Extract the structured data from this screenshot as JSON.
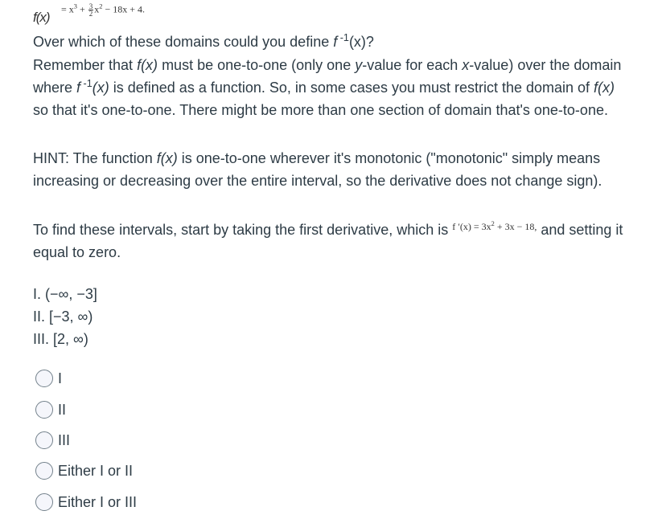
{
  "header": {
    "fx_label": "f(x)",
    "rhs_a": "= x",
    "rhs_a_exp": "3",
    "rhs_plus1": " + ",
    "frac_num": "3",
    "frac_den": "2",
    "rhs_x2": "x",
    "rhs_x2_exp": "2",
    "rhs_rest": " − 18x + 4."
  },
  "question": {
    "line1_prefix": "Over which of these domains could you define ",
    "line1_f": "f",
    "line1_exp": " -1",
    "line1_suffix": "(x)?",
    "para1_a": "Remember that ",
    "para1_fx": "f(x)",
    "para1_b": " must be one-to-one (only one ",
    "para1_y": "y",
    "para1_c": "-value for each ",
    "para1_x": "x",
    "para1_d": "-value) over the domain where ",
    "para1_f": "f",
    "para1_exp": " -1",
    "para1_x2": "(x)",
    "para1_e": " is defined as a function. So, in some cases you must restrict the domain of ",
    "para1_fx2": "f(x)",
    "para1_f_end": " so that it's one-to-one. There might be more than one section of domain that's one-to-one.",
    "hint_a": "HINT: The function ",
    "hint_fx": "f(x)",
    "hint_b": " is one-to-one wherever it's monotonic (\"monotonic\" simply means increasing or decreasing over the entire interval, so the derivative does not change sign).",
    "find_a": "To find these intervals, start by taking the first derivative, which is ",
    "deriv_lhs": "f ′(x) = 3x",
    "deriv_exp": "2",
    "deriv_rest": " + 3x − 18,",
    "find_b": " and setting it equal to zero."
  },
  "intervals": [
    "I. (−∞, −3]",
    "II. [−3, ∞)",
    "III. [2, ∞)"
  ],
  "options": [
    {
      "label": "I",
      "selected": false
    },
    {
      "label": "II",
      "selected": false
    },
    {
      "label": "III",
      "selected": false
    },
    {
      "label": "Either I or II",
      "selected": false
    },
    {
      "label": "Either I or III",
      "selected": false
    }
  ]
}
